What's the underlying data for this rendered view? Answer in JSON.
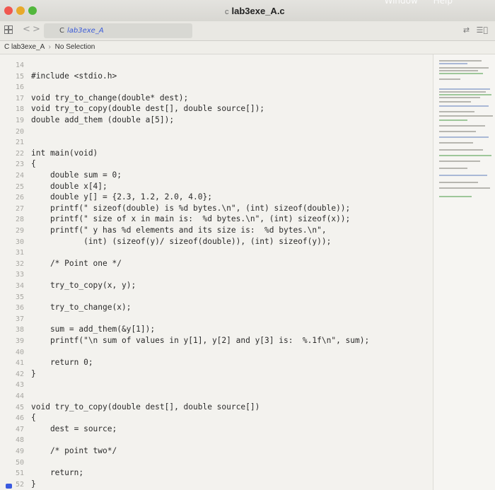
{
  "window": {
    "title": "lab3exe_A.c",
    "menu_visible": [
      "Window",
      "Help"
    ]
  },
  "tab": {
    "label": "lab3exe_A"
  },
  "jumpbar": {
    "file": "lab3exe_A",
    "selection": "No Selection"
  },
  "code_lines": [
    {
      "num": "14",
      "text": ""
    },
    {
      "num": "15",
      "text": "#include <stdio.h>"
    },
    {
      "num": "16",
      "text": ""
    },
    {
      "num": "17",
      "text": "void try_to_change(double* dest);"
    },
    {
      "num": "18",
      "text": "void try_to_copy(double dest[], double source[]);"
    },
    {
      "num": "19",
      "text": "double add_them (double a[5]);"
    },
    {
      "num": "20",
      "text": ""
    },
    {
      "num": "21",
      "text": ""
    },
    {
      "num": "22",
      "text": "int main(void)"
    },
    {
      "num": "23",
      "text": "{"
    },
    {
      "num": "24",
      "text": "    double sum = 0;"
    },
    {
      "num": "25",
      "text": "    double x[4];"
    },
    {
      "num": "26",
      "text": "    double y[] = {2.3, 1.2, 2.0, 4.0};"
    },
    {
      "num": "27",
      "text": "    printf(\" sizeof(double) is %d bytes.\\n\", (int) sizeof(double));"
    },
    {
      "num": "28",
      "text": "    printf(\" size of x in main is:  %d bytes.\\n\", (int) sizeof(x));"
    },
    {
      "num": "29",
      "text": "    printf(\" y has %d elements and its size is:  %d bytes.\\n\","
    },
    {
      "num": "30",
      "text": "           (int) (sizeof(y)/ sizeof(double)), (int) sizeof(y));"
    },
    {
      "num": "31",
      "text": ""
    },
    {
      "num": "32",
      "text": "    /* Point one */"
    },
    {
      "num": "33",
      "text": ""
    },
    {
      "num": "34",
      "text": "    try_to_copy(x, y);"
    },
    {
      "num": "35",
      "text": ""
    },
    {
      "num": "36",
      "text": "    try_to_change(x);"
    },
    {
      "num": "37",
      "text": ""
    },
    {
      "num": "38",
      "text": "    sum = add_them(&y[1]);"
    },
    {
      "num": "39",
      "text": "    printf(\"\\n sum of values in y[1], y[2] and y[3] is:  %.1f\\n\", sum);"
    },
    {
      "num": "40",
      "text": ""
    },
    {
      "num": "41",
      "text": "    return 0;"
    },
    {
      "num": "42",
      "text": "}"
    },
    {
      "num": "43",
      "text": ""
    },
    {
      "num": "44",
      "text": ""
    },
    {
      "num": "45",
      "text": "void try_to_copy(double dest[], double source[])"
    },
    {
      "num": "46",
      "text": "{"
    },
    {
      "num": "47",
      "text": "    dest = source;"
    },
    {
      "num": "48",
      "text": ""
    },
    {
      "num": "49",
      "text": "    /* point two*/"
    },
    {
      "num": "50",
      "text": ""
    },
    {
      "num": "51",
      "text": "    return;"
    },
    {
      "num": "52",
      "text": "}"
    }
  ]
}
